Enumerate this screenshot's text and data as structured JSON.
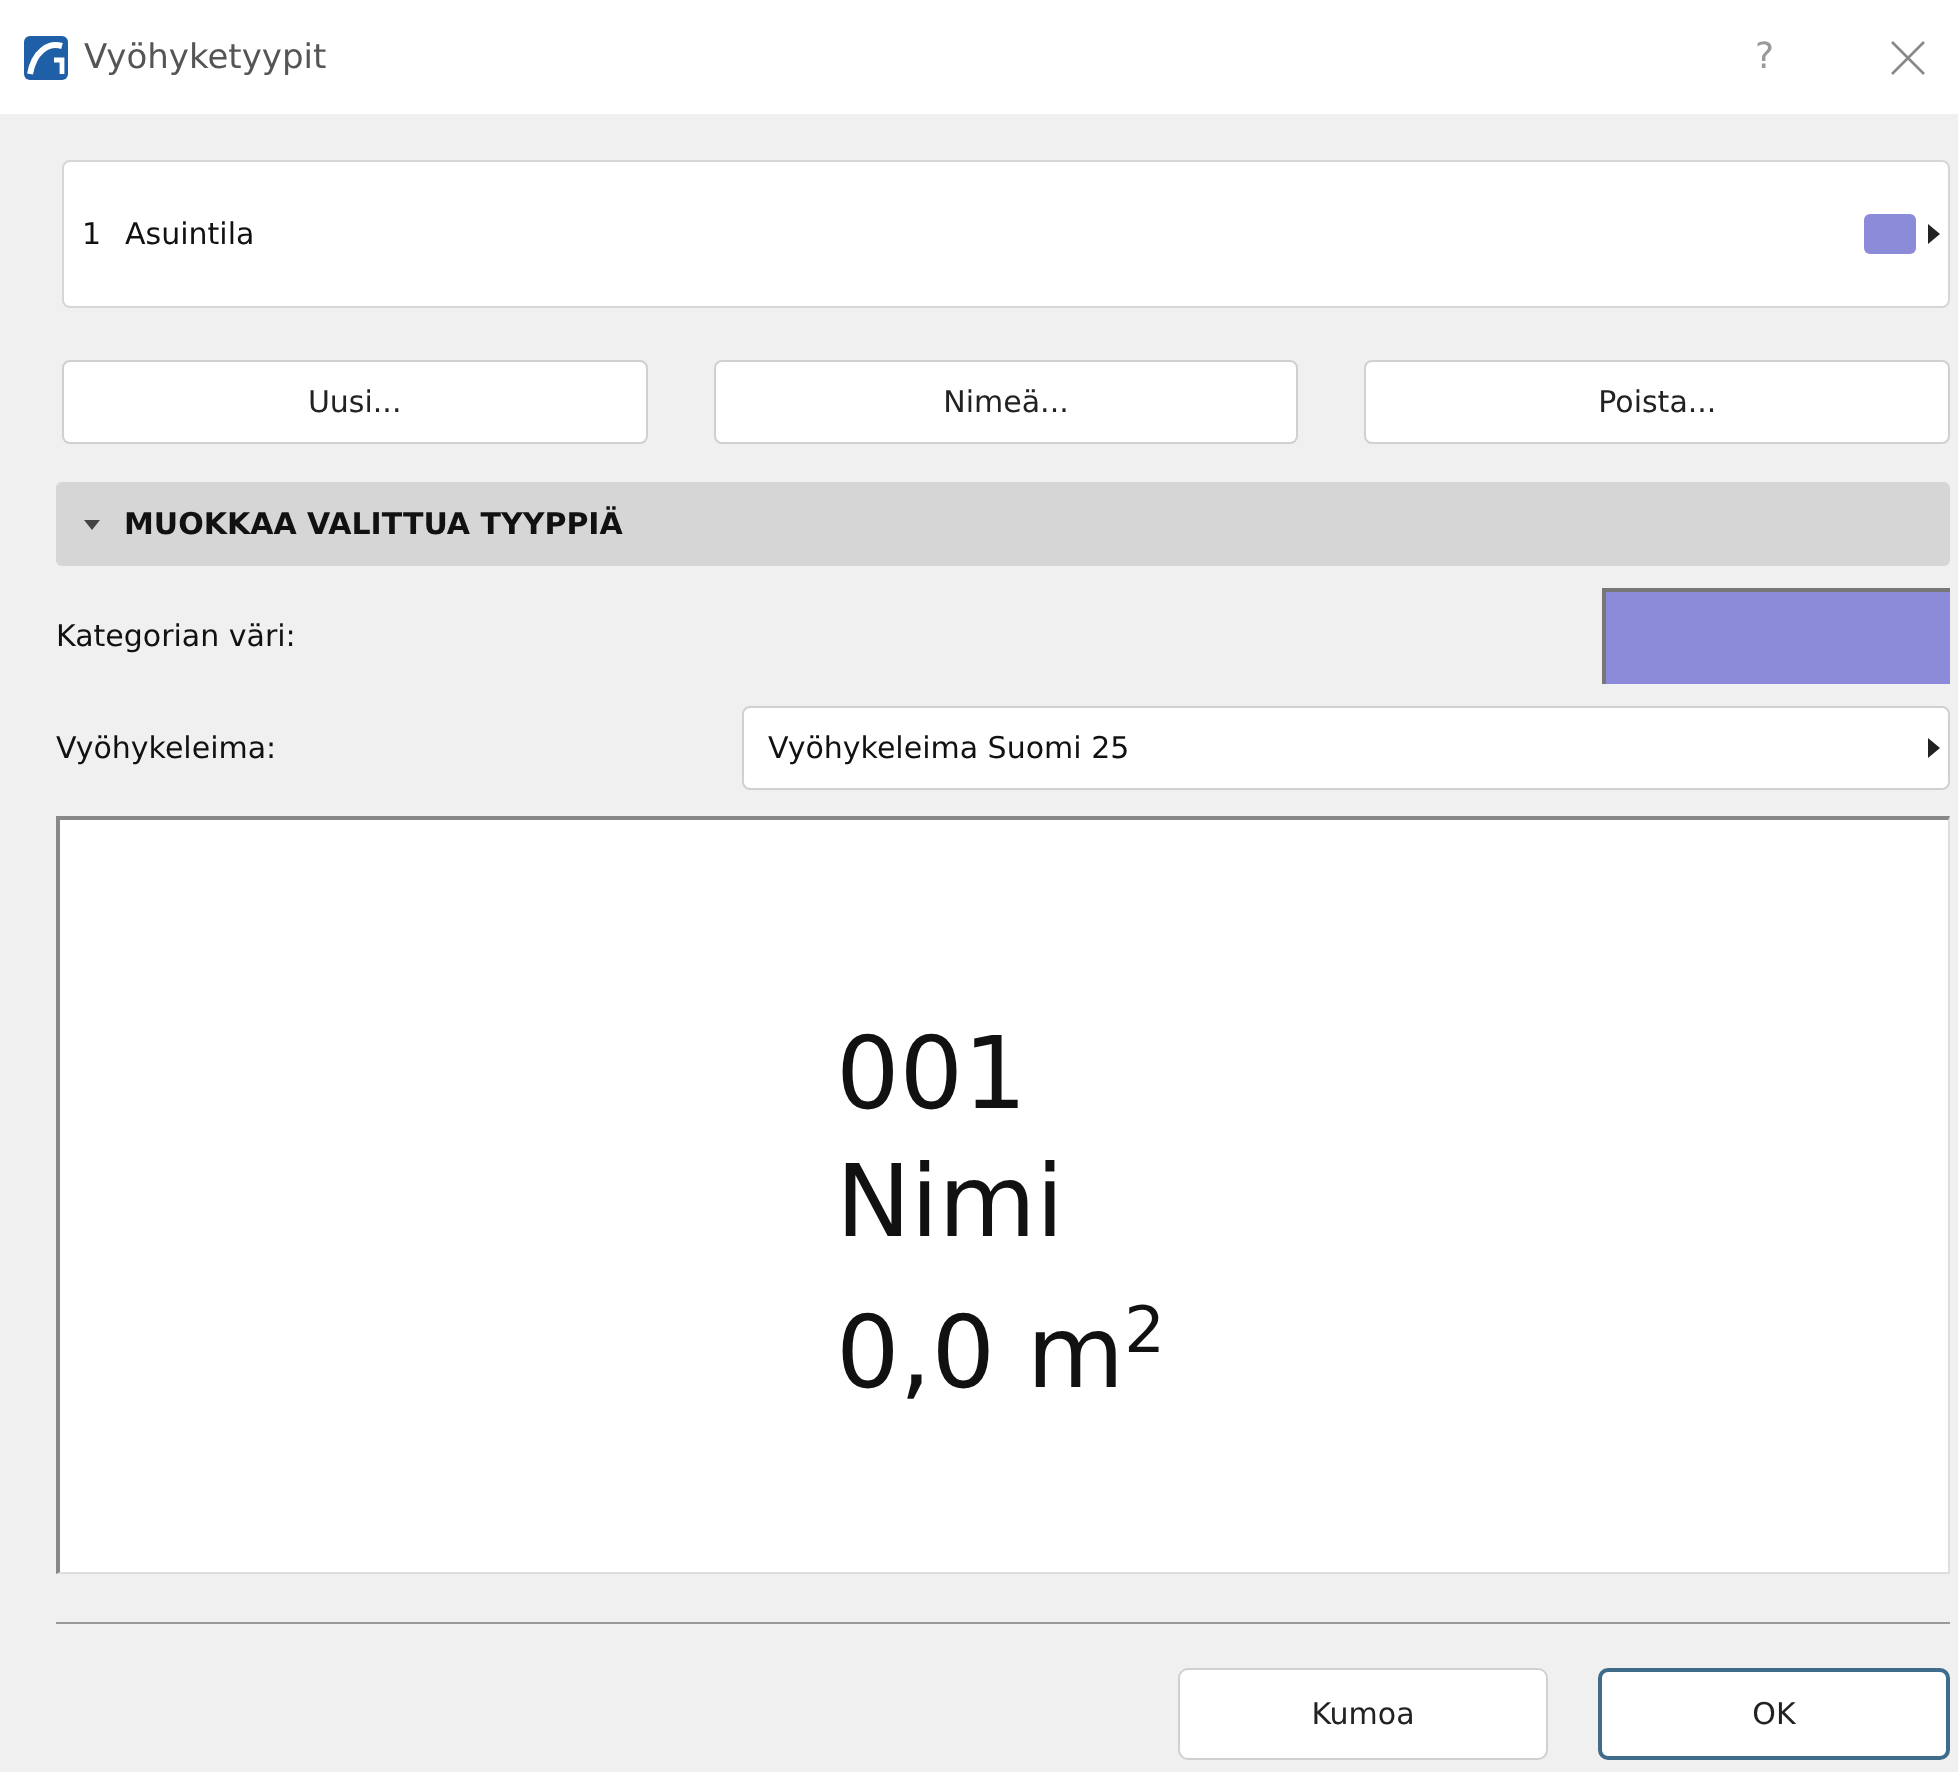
{
  "window": {
    "title": "Vyöhyketyypit",
    "help": "?"
  },
  "zone_types": [
    {
      "number": "1",
      "name": "Asuintila",
      "color": "#8b8bd9"
    }
  ],
  "buttons": [
    "Uusi...",
    "Nimeä...",
    "Poista..."
  ],
  "section": {
    "title": "MUOKKAA VALITTUA TYYPPIÄ",
    "expanded": true
  },
  "category_color": {
    "label": "Kategorian väri:",
    "color": "#8b8bd9"
  },
  "zone_stamp": {
    "label": "Vyöhykeleima:",
    "value": "Vyöhykeleima Suomi 25"
  },
  "preview": {
    "lines": [
      "001",
      "Nimi",
      "0,0 m$^{2}$"
    ]
  },
  "footer_buttons": [
    {
      "label": "Kumoa",
      "default": false
    },
    {
      "label": "OK",
      "default": true
    }
  ]
}
